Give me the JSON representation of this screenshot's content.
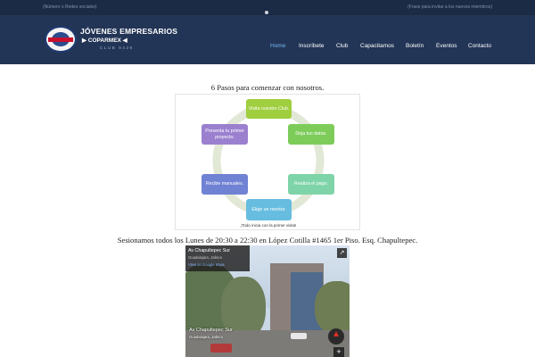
{
  "topbar": {
    "left_text": "(Número o Redes sociales)",
    "right_text": "(Frase para invitar a los nuevos miembros)"
  },
  "logo": {
    "seal_text": "TOASTMASTERS",
    "line1": "JÓVENES EMPRESARIOS",
    "line2": "▶ COPARMEX ◀",
    "line3": "CLUB 9429"
  },
  "nav": {
    "items": [
      "Home",
      "Inscríbete",
      "Club",
      "Capacitamos",
      "Boletín",
      "Eventos",
      "Contacto"
    ],
    "active": "Home"
  },
  "section_title": "6 Pasos para comenzar con nosotros.",
  "diagram": {
    "steps": [
      {
        "label": "Visita nuestro Club.",
        "color": "#9fce3e"
      },
      {
        "label": "Deja tus datos.",
        "color": "#7dcc5a"
      },
      {
        "label": "Realiza el pago.",
        "color": "#7ed4a8"
      },
      {
        "label": "Elige un mentor.",
        "color": "#67bde0"
      },
      {
        "label": "Recibe manuales.",
        "color": "#6f82d3"
      },
      {
        "label": "Presenta tu primer proyecto.",
        "color": "#9b80cf"
      }
    ],
    "caption": "¡Todo inicia con la primer visita!"
  },
  "sessions_text": "Sesionamos todos los Lunes de 20:30 a 22:30 en López Cotilla #1465 1er Piso. Esq. Chapultepec.",
  "map": {
    "place_name": "Av Chapultepec Sur",
    "place_city": "Guadalajara, Jalisco",
    "link_text": "View on Google Maps",
    "street_label": "Av Chapultepec Sur",
    "street_sub": "Guadalajara, Jalisco",
    "expand_icon": "↗",
    "zoom_icon": "+"
  },
  "colors": {
    "topbar_bg": "#1b2a45",
    "header_bg": "#233556",
    "nav_active": "#74b8ee"
  }
}
